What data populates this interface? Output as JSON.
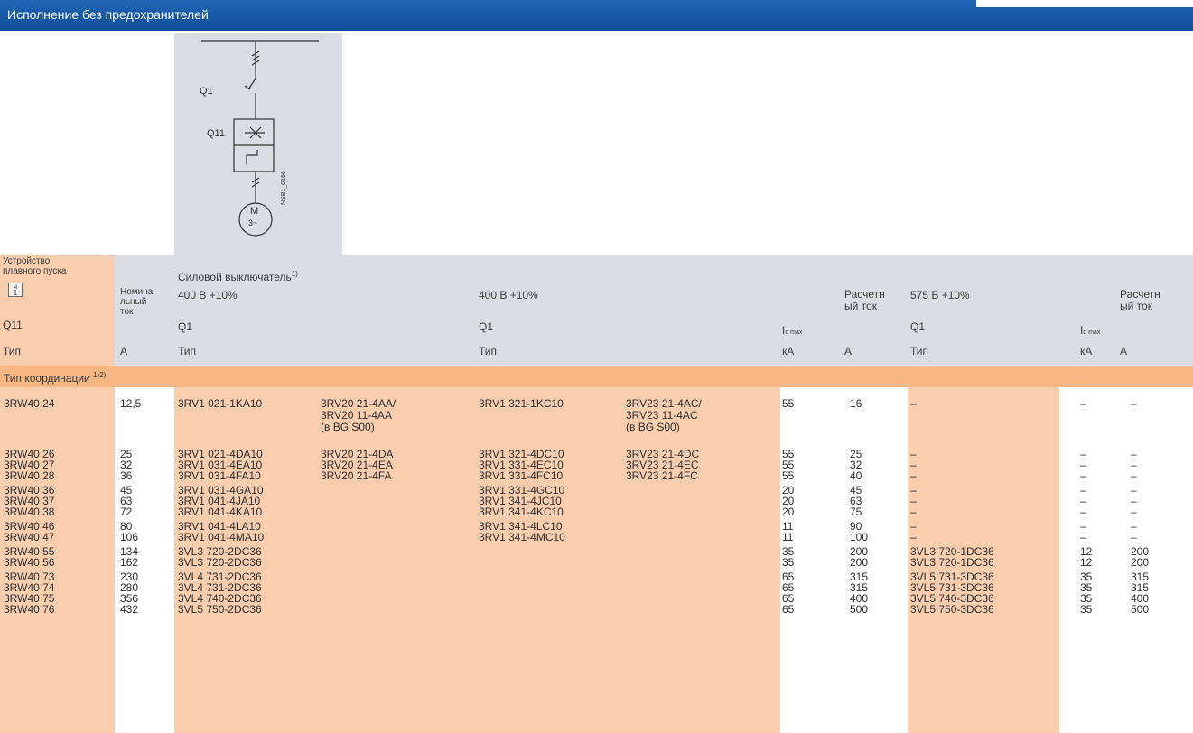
{
  "title": "Исполнение без предохранителей",
  "diagram": {
    "q1": "Q1",
    "q11": "Q11",
    "motor_m": "M",
    "motor_phase": "3~",
    "side_code": "NSB1_0156"
  },
  "headers": {
    "device": "Устройство\nплавного пуска",
    "device_icon_text": "ч\n1",
    "q11": "Q11",
    "type": "Тип",
    "nominal": "Номина\nльный\nток",
    "unit_a": "A",
    "breaker": "Силовой выключатель",
    "breaker_note": "1)",
    "v400": "400 B +10%",
    "v575": "575 B +10%",
    "q1": "Q1",
    "iq": "I",
    "iq_sub": "q max",
    "ka": "кА",
    "rated": "Расчетн\nый ток",
    "coordination": "Тип координации",
    "coordination_note": "1)2)"
  },
  "rows": [
    {
      "dev": "3RW40 24",
      "nom": "12,5",
      "q1a": "3RV1 021-1KA10",
      "q1b": "3RV20 21-4AA/\n3RV20 11-4AA\n(в BG S00)",
      "q1c": "3RV1 321-1KC10",
      "q1d": "3RV23 21-4AC/\n3RV23 11-4AC\n(в BG S00)",
      "ika": "55",
      "ra": "16",
      "q575": "–",
      "ikb": "–",
      "rb": "–"
    },
    {
      "dev": "3RW40 26",
      "nom": "25",
      "q1a": "3RV1 021-4DA10",
      "q1b": "3RV20 21-4DA",
      "q1c": "3RV1 321-4DC10",
      "q1d": "3RV23 21-4DC",
      "ika": "55",
      "ra": "25",
      "q575": "–",
      "ikb": "–",
      "rb": "–"
    },
    {
      "dev": "3RW40 27",
      "nom": "32",
      "q1a": "3RV1 031-4EA10",
      "q1b": "3RV20 21-4EA",
      "q1c": "3RV1 331-4EC10",
      "q1d": "3RV23 21-4EC",
      "ika": "55",
      "ra": "32",
      "q575": "–",
      "ikb": "–",
      "rb": "–"
    },
    {
      "dev": "3RW40 28",
      "nom": "36",
      "q1a": "3RV1 031-4FA10",
      "q1b": "3RV20 21-4FA",
      "q1c": "3RV1 331-4FC10",
      "q1d": "3RV23 21-4FC",
      "ika": "55",
      "ra": "40",
      "q575": "–",
      "ikb": "–",
      "rb": "–"
    },
    {
      "dev": "3RW40 36",
      "nom": "45",
      "q1a": "3RV1 031-4GA10",
      "q1b": "",
      "q1c": "3RV1 331-4GC10",
      "q1d": "",
      "ika": "20",
      "ra": "45",
      "q575": "–",
      "ikb": "–",
      "rb": "–"
    },
    {
      "dev": "3RW40 37",
      "nom": "63",
      "q1a": "3RV1 041-4JA10",
      "q1b": "",
      "q1c": "3RV1 341-4JC10",
      "q1d": "",
      "ika": "20",
      "ra": "63",
      "q575": "–",
      "ikb": "–",
      "rb": "–"
    },
    {
      "dev": "3RW40 38",
      "nom": "72",
      "q1a": "3RV1 041-4KA10",
      "q1b": "",
      "q1c": "3RV1 341-4KC10",
      "q1d": "",
      "ika": "20",
      "ra": "75",
      "q575": "–",
      "ikb": "–",
      "rb": "–"
    },
    {
      "dev": "3RW40 46",
      "nom": "80",
      "q1a": "3RV1 041-4LA10",
      "q1b": "",
      "q1c": "3RV1 341-4LC10",
      "q1d": "",
      "ika": "11",
      "ra": "90",
      "q575": "–",
      "ikb": "–",
      "rb": "–"
    },
    {
      "dev": "3RW40 47",
      "nom": "106",
      "q1a": "3RV1 041-4MA10",
      "q1b": "",
      "q1c": "3RV1 341-4MC10",
      "q1d": "",
      "ika": "11",
      "ra": "100",
      "q575": "–",
      "ikb": "–",
      "rb": "–"
    },
    {
      "dev": "3RW40 55",
      "nom": "134",
      "q1a": "3VL3 720-2DC36",
      "q1b": "",
      "q1c": "",
      "q1d": "",
      "ika": "35",
      "ra": "200",
      "q575": "3VL3 720-1DC36",
      "ikb": "12",
      "rb": "200"
    },
    {
      "dev": "3RW40 56",
      "nom": "162",
      "q1a": "3VL3 720-2DC36",
      "q1b": "",
      "q1c": "",
      "q1d": "",
      "ika": "35",
      "ra": "200",
      "q575": "3VL3 720-1DC36",
      "ikb": "12",
      "rb": "200"
    },
    {
      "dev": "3RW40 73",
      "nom": "230",
      "q1a": "3VL4 731-2DC36",
      "q1b": "",
      "q1c": "",
      "q1d": "",
      "ika": "65",
      "ra": "315",
      "q575": "3VL5 731-3DC36",
      "ikb": "35",
      "rb": "315"
    },
    {
      "dev": "3RW40 74",
      "nom": "280",
      "q1a": "3VL4 731-2DC36",
      "q1b": "",
      "q1c": "",
      "q1d": "",
      "ika": "65",
      "ra": "315",
      "q575": "3VL5 731-3DC36",
      "ikb": "35",
      "rb": "315"
    },
    {
      "dev": "3RW40 75",
      "nom": "356",
      "q1a": "3VL4 740-2DC36",
      "q1b": "",
      "q1c": "",
      "q1d": "",
      "ika": "65",
      "ra": "400",
      "q575": "3VL5 740-3DC36",
      "ikb": "35",
      "rb": "400"
    },
    {
      "dev": "3RW40 76",
      "nom": "432",
      "q1a": "3VL5 750-2DC36",
      "q1b": "",
      "q1c": "",
      "q1d": "",
      "ika": "65",
      "ra": "500",
      "q575": "3VL5 750-3DC36",
      "ikb": "35",
      "rb": "500"
    }
  ],
  "colors": {
    "title_bar": "#1159a8",
    "header_gray": "#dadde3",
    "orange_band": "#f6b783",
    "orange_col": "#f8ceaf"
  }
}
